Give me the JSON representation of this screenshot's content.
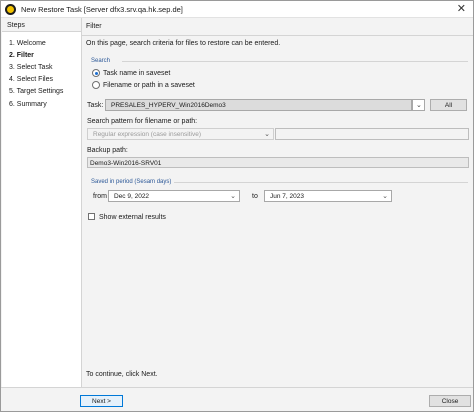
{
  "window": {
    "title": "New Restore Task [Server dfx3.srv.qa.hk.sep.de]",
    "close_glyph": "✕"
  },
  "steps": {
    "header": "Steps",
    "items": [
      {
        "label": "1. Welcome",
        "active": false
      },
      {
        "label": "2. Filter",
        "active": true
      },
      {
        "label": "3. Select Task",
        "active": false
      },
      {
        "label": "4. Select Files",
        "active": false
      },
      {
        "label": "5. Target Settings",
        "active": false
      },
      {
        "label": "6. Summary",
        "active": false
      }
    ]
  },
  "main": {
    "header": "Filter",
    "description": "On this page, search criteria for files to restore can be entered.",
    "search_group": {
      "title": "Search",
      "option_task": "Task name in saveset",
      "option_path": "Filename or path in a saveset",
      "selected": "task"
    },
    "task": {
      "label": "Task:",
      "value": "PRESALES_HYPERV_Win2016Demo3",
      "all_button": "All"
    },
    "pattern": {
      "label": "Search pattern for filename or path:",
      "mode_value": "Regular expression (case insensitive)",
      "value": ""
    },
    "backup_path": {
      "label": "Backup path:",
      "value": "Demo3-Win2016-SRV01"
    },
    "period_group": {
      "title": "Saved in period (Sesam days)",
      "from_label": "from",
      "from_value": "Dec 9, 2022",
      "to_label": "to",
      "to_value": "Jun 7, 2023"
    },
    "show_external": {
      "label": "Show external results",
      "checked": false
    },
    "footer_hint": "To continue, click Next."
  },
  "buttons": {
    "next": "Next >",
    "close": "Close"
  },
  "colors": {
    "accent": "#0078d7",
    "group_title": "#2b5797",
    "radio_fill": "#1e6fd0"
  },
  "icons": {
    "dropdown": "chevron-down-icon",
    "app": "sesam-app-icon",
    "close": "close-icon"
  }
}
